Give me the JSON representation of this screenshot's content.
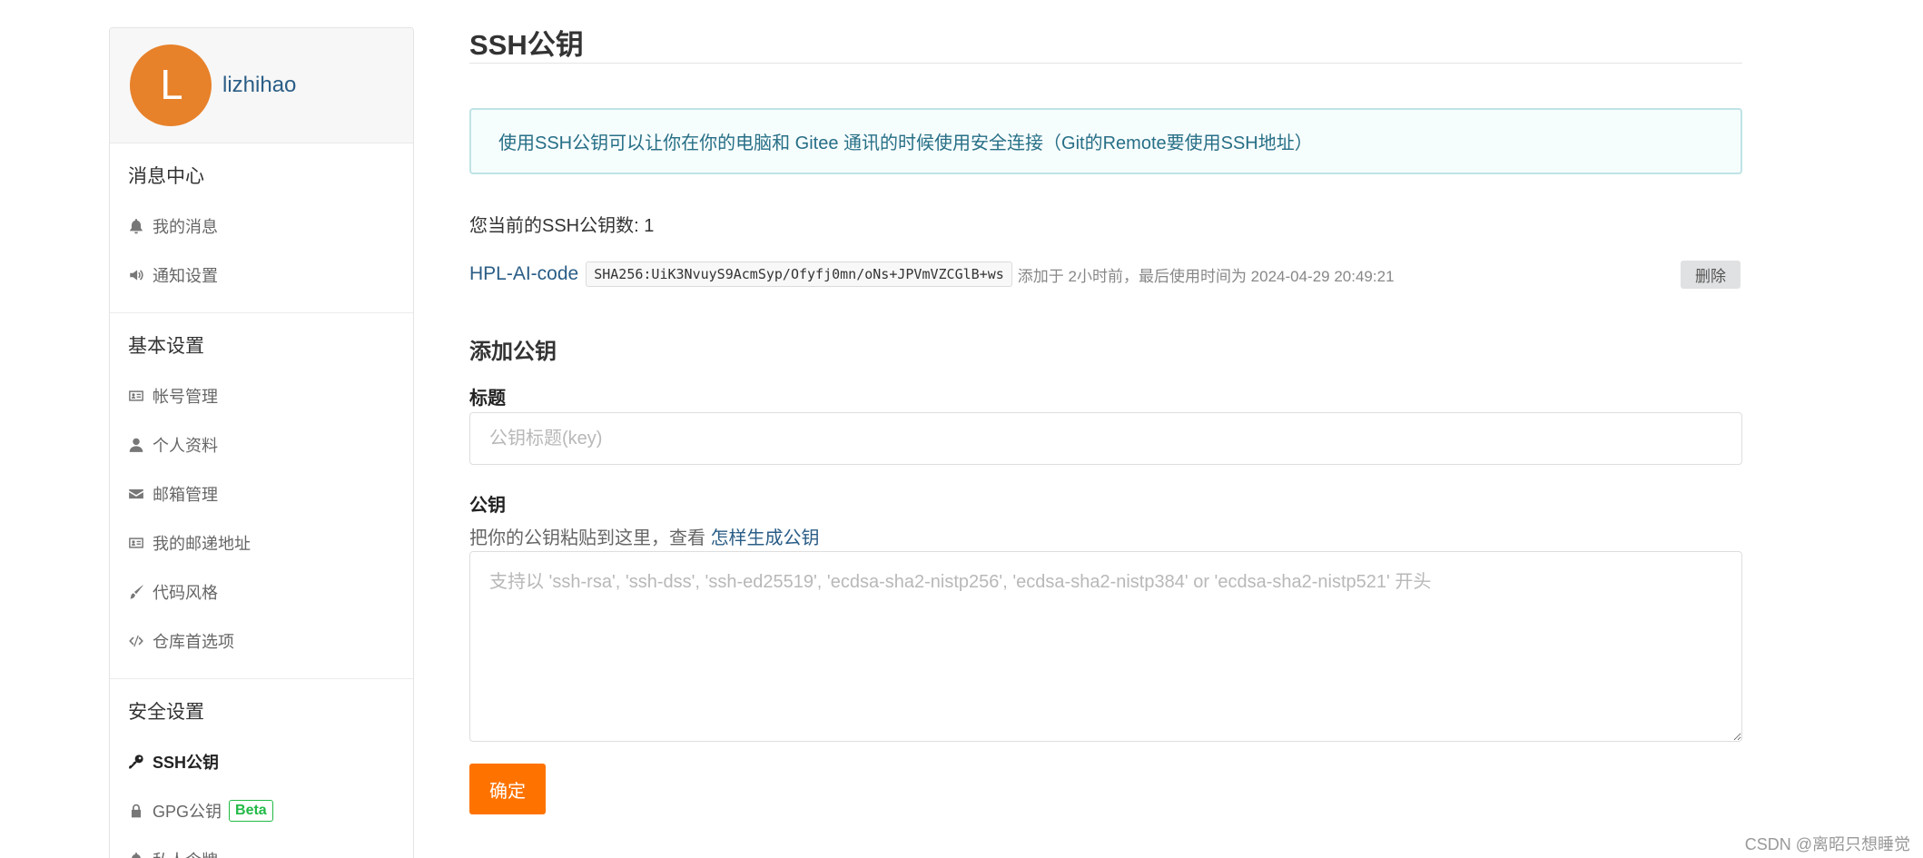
{
  "user": {
    "avatar_letter": "L",
    "name": "lizhihao"
  },
  "sidebar": {
    "sections": [
      {
        "title": "消息中心",
        "items": [
          {
            "label": "我的消息",
            "icon": "bell-icon"
          },
          {
            "label": "通知设置",
            "icon": "volume-icon"
          }
        ]
      },
      {
        "title": "基本设置",
        "items": [
          {
            "label": "帐号管理",
            "icon": "id-card-icon"
          },
          {
            "label": "个人资料",
            "icon": "user-icon"
          },
          {
            "label": "邮箱管理",
            "icon": "envelope-icon"
          },
          {
            "label": "我的邮递地址",
            "icon": "address-card-icon"
          },
          {
            "label": "代码风格",
            "icon": "paint-brush-icon"
          },
          {
            "label": "仓库首选项",
            "icon": "code-icon"
          }
        ]
      },
      {
        "title": "安全设置",
        "items": [
          {
            "label": "SSH公钥",
            "icon": "key-icon",
            "active": true
          },
          {
            "label": "GPG公钥",
            "icon": "lock-icon",
            "badge": "Beta"
          },
          {
            "label": "私人令牌",
            "icon": "bell-icon"
          }
        ]
      }
    ]
  },
  "main": {
    "title": "SSH公钥",
    "info": "使用SSH公钥可以让你在你的电脑和 Gitee 通讯的时候使用安全连接（Git的Remote要使用SSH地址）",
    "key_count_text": "您当前的SSH公钥数: 1",
    "keys": [
      {
        "name": "HPL-AI-code",
        "fingerprint": "SHA256:UiK3NvuyS9AcmSyp/Ofyfj0mn/oNs+JPVmVZCGlB+ws",
        "meta": "添加于 2小时前，最后使用时间为 2024-04-29 20:49:21",
        "delete_label": "删除"
      }
    ],
    "add_title": "添加公钥",
    "title_label": "标题",
    "title_placeholder": "公钥标题(key)",
    "key_label": "公钥",
    "key_help_prefix": "把你的公钥粘贴到这里，查看",
    "key_help_link": "怎样生成公钥",
    "key_placeholder": "支持以 'ssh-rsa', 'ssh-dss', 'ssh-ed25519', 'ecdsa-sha2-nistp256', 'ecdsa-sha2-nistp384' or 'ecdsa-sha2-nistp521' 开头",
    "submit_label": "确定"
  },
  "watermark": "CSDN @离昭只想睡觉",
  "colors": {
    "accent": "#fe7300",
    "avatar": "#e7812a",
    "link": "#2a5d86",
    "info_bg": "#f6fdfd",
    "info_border": "#bfe3e5",
    "badge": "#21ba45"
  }
}
